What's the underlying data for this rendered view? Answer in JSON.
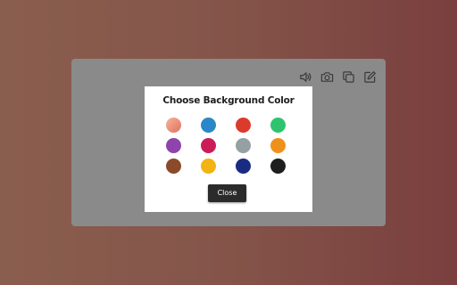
{
  "toolbar": {
    "icons": [
      "volume-icon",
      "camera-icon",
      "copy-icon",
      "edit-icon"
    ],
    "icon_color": "#3a3a3a"
  },
  "modal": {
    "title": "Choose Background Color",
    "close_label": "Close",
    "swatches": [
      {
        "name": "peach",
        "color": "linear-gradient(135deg,#f7b39a,#e0715e)"
      },
      {
        "name": "blue",
        "color": "#2a87c8"
      },
      {
        "name": "red",
        "color": "#db3b2c"
      },
      {
        "name": "green",
        "color": "#2ec46f"
      },
      {
        "name": "purple",
        "color": "#8e44ad"
      },
      {
        "name": "crimson",
        "color": "#cc1c57"
      },
      {
        "name": "gray",
        "color": "#95a0a3"
      },
      {
        "name": "orange",
        "color": "#f0901c"
      },
      {
        "name": "brown",
        "color": "#8b4a2a"
      },
      {
        "name": "amber",
        "color": "#f3b312"
      },
      {
        "name": "navy",
        "color": "#1a2b82"
      },
      {
        "name": "black",
        "color": "#1e1e1e"
      }
    ]
  },
  "colors": {
    "panel": "#8a8a8a",
    "modal": "#ffffff",
    "button": "#2b2b2b"
  }
}
